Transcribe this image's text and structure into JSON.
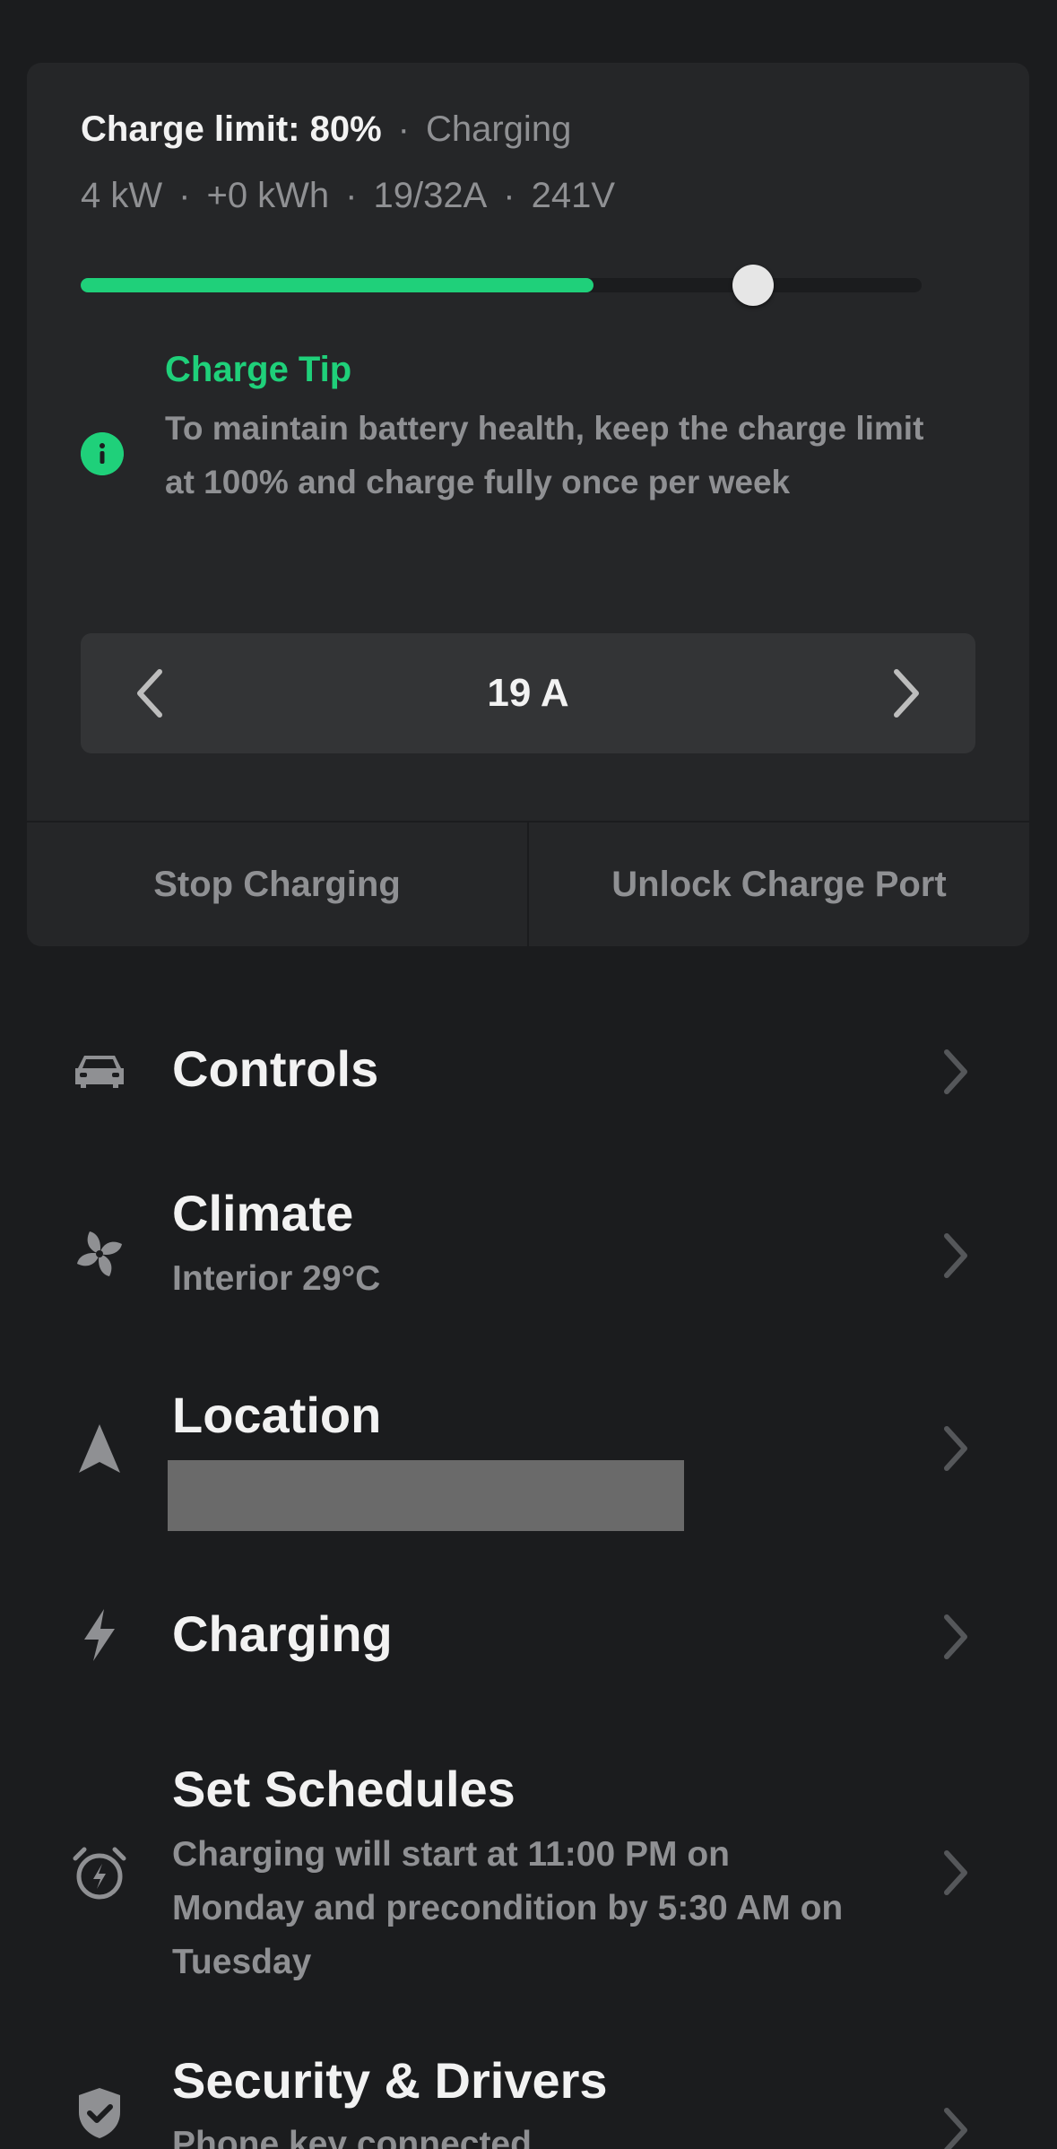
{
  "charge_panel": {
    "limit_label": "Charge limit: 80%",
    "status": "Charging",
    "stats": [
      "4 kW",
      "+0 kWh",
      "19/32A",
      "241V"
    ],
    "charge_level_fraction": 0.61,
    "limit_fraction": 0.8,
    "tip_title": "Charge Tip",
    "tip_body": "To maintain battery health, keep the charge limit at 100% and charge fully once per week",
    "amperage": "19 A",
    "stop_label": "Stop Charging",
    "unlock_label": "Unlock Charge Port"
  },
  "menu": {
    "controls": {
      "title": "Controls",
      "icon": "car-icon"
    },
    "climate": {
      "title": "Climate",
      "subtitle": "Interior 29°C",
      "icon": "fan-icon"
    },
    "location": {
      "title": "Location",
      "icon": "navigation-arrow-icon"
    },
    "charging": {
      "title": "Charging",
      "icon": "lightning-bolt-icon"
    },
    "schedules": {
      "title": "Set Schedules",
      "subtitle": "Charging will start at 11:00 PM on Monday and precondition by 5:30 AM on Tuesday",
      "icon": "alarm-clock-icon"
    },
    "security": {
      "title": "Security & Drivers",
      "subtitle": "Phone key connected",
      "icon": "shield-check-icon"
    }
  },
  "colors": {
    "background": "#1b1c1e",
    "card": "#252628",
    "accent_green": "#1fd07a",
    "muted_text": "#8f9093"
  }
}
